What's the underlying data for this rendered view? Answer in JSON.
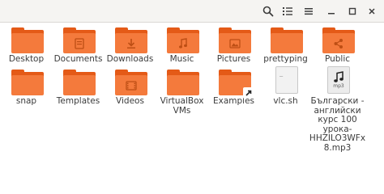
{
  "window": {
    "toolbar_icons": [
      "search-icon",
      "list-view-icon",
      "menu-icon",
      "minimize-icon",
      "maximize-icon",
      "close-icon"
    ]
  },
  "items": [
    {
      "label": "Desktop",
      "icon": "folder"
    },
    {
      "label": "Documents",
      "icon": "folder-documents"
    },
    {
      "label": "Downloads",
      "icon": "folder-download"
    },
    {
      "label": "Music",
      "icon": "folder-music"
    },
    {
      "label": "Pictures",
      "icon": "folder-pictures"
    },
    {
      "label": "prettyping",
      "icon": "folder"
    },
    {
      "label": "Public",
      "icon": "folder-publicshare"
    },
    {
      "label": "snap",
      "icon": "folder"
    },
    {
      "label": "Templates",
      "icon": "folder"
    },
    {
      "label": "Videos",
      "icon": "folder-videos"
    },
    {
      "label": "VirtualBox VMs",
      "icon": "folder"
    },
    {
      "label": "Examples",
      "icon": "folder-symlink"
    },
    {
      "label": "vlc.sh",
      "icon": "text-x-script",
      "file_prompt": "_"
    },
    {
      "label": "Български - английски курс 100 урока-HHZILO3WFx8.mp3",
      "icon": "audio-x-generic",
      "file_ext": "mp3"
    }
  ],
  "colors": {
    "folder_back": "#e45a17",
    "folder_front": "#f47a3c",
    "headerbar": "#f5f4f2",
    "label_text": "#3c3c3c"
  }
}
